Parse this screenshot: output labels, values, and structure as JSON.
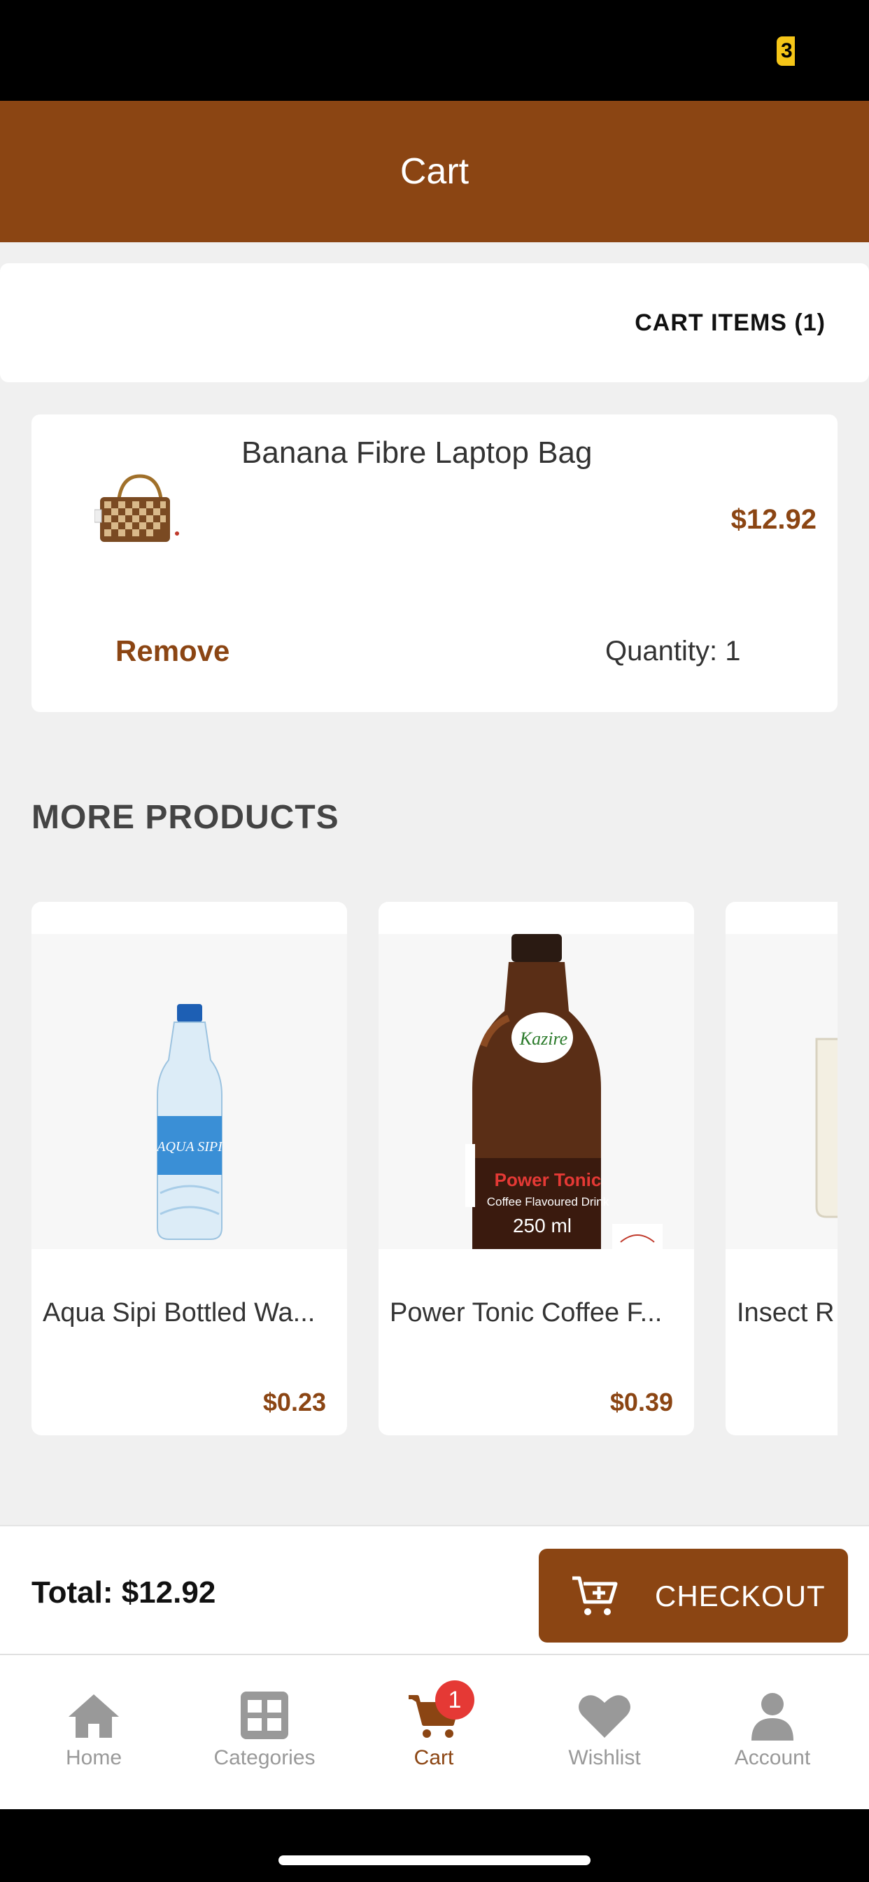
{
  "status_bar": {
    "badge": "3"
  },
  "header": {
    "title": "Cart"
  },
  "cart_summary": {
    "label": "CART ITEMS (1)"
  },
  "cart_items": [
    {
      "name": "Banana Fibre Laptop Bag",
      "price": "$12.92",
      "remove_label": "Remove",
      "quantity_label": "Quantity: 1"
    }
  ],
  "more_products": {
    "title": "MORE PRODUCTS",
    "items": [
      {
        "name": "Aqua Sipi Bottled Wa...",
        "price": "$0.23",
        "bottle_text": "AQUA SIPI"
      },
      {
        "name": "Power Tonic Coffee F...",
        "price": "$0.39",
        "logo_text": "Kazire",
        "label_text": "Power Tonic",
        "sub_text": "Coffee Flavoured Drink",
        "volume_text": "250 ml"
      },
      {
        "name": "Insect R",
        "price": ""
      }
    ]
  },
  "footer": {
    "total": "Total: $12.92",
    "checkout_label": "CHECKOUT"
  },
  "tabs": [
    {
      "label": "Home",
      "icon": "home-icon"
    },
    {
      "label": "Categories",
      "icon": "grid-icon"
    },
    {
      "label": "Cart",
      "icon": "cart-icon",
      "badge": "1",
      "active": true
    },
    {
      "label": "Wishlist",
      "icon": "heart-icon"
    },
    {
      "label": "Account",
      "icon": "user-icon"
    }
  ],
  "colors": {
    "brand": "#8b4513",
    "badge": "#e53935",
    "inactive": "#999999"
  }
}
